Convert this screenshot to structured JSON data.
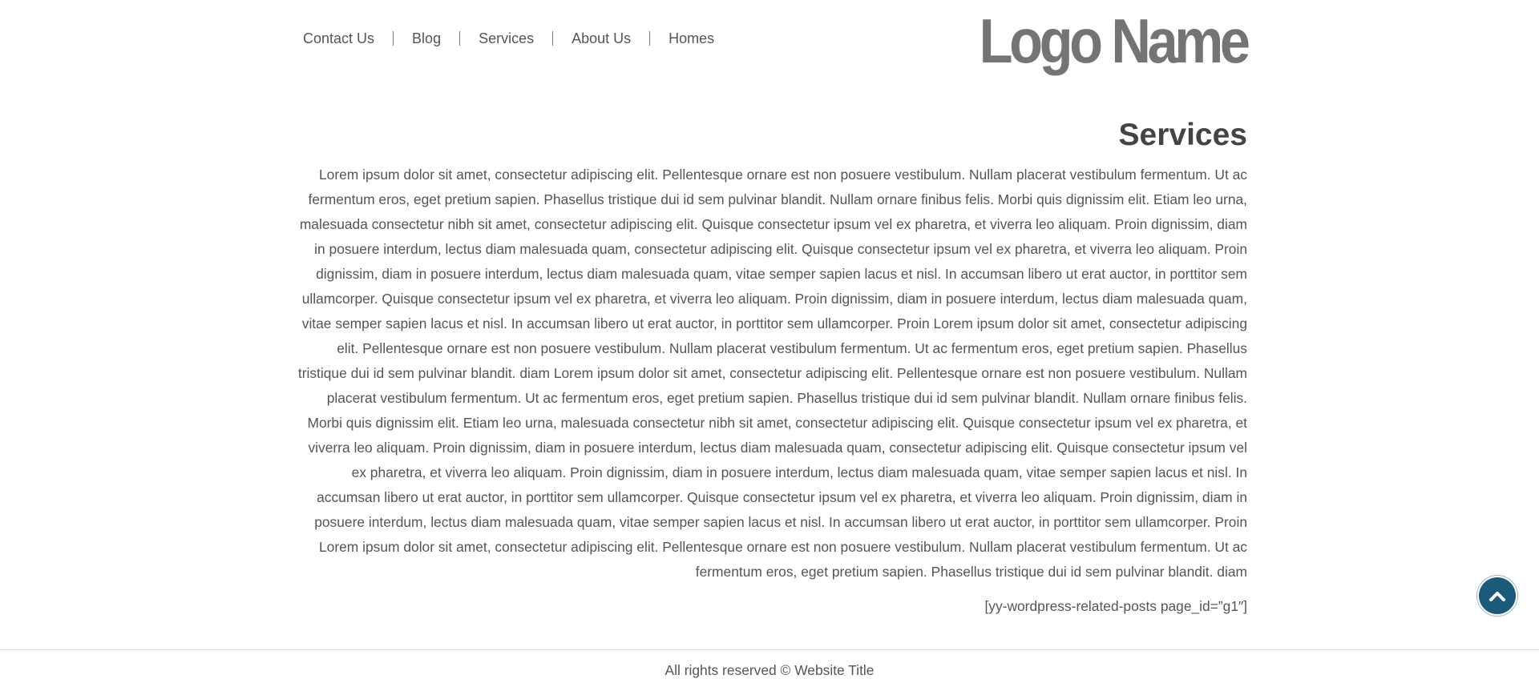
{
  "header": {
    "nav": [
      {
        "label": "Contact Us"
      },
      {
        "label": "Blog"
      },
      {
        "label": "Services"
      },
      {
        "label": "About Us"
      },
      {
        "label": "Homes"
      }
    ],
    "logo_text": "Logo Name"
  },
  "main": {
    "title": "Services",
    "body": "Lorem ipsum dolor sit amet, consectetur adipiscing elit. Pellentesque ornare est non posuere vestibulum. Nullam placerat vestibulum fermentum. Ut ac fermentum eros, eget pretium sapien. Phasellus tristique dui id sem pulvinar blandit. Nullam ornare finibus felis. Morbi quis dignissim elit. Etiam leo urna, malesuada consectetur nibh sit amet, consectetur adipiscing elit. Quisque consectetur ipsum vel ex pharetra, et viverra leo aliquam. Proin dignissim, diam in posuere interdum, lectus diam malesuada quam, consectetur adipiscing elit. Quisque consectetur ipsum vel ex pharetra, et viverra leo aliquam. Proin dignissim, diam in posuere interdum, lectus diam malesuada quam, vitae semper sapien lacus et nisl. In accumsan libero ut erat auctor, in porttitor sem ullamcorper. Quisque consectetur ipsum vel ex pharetra, et viverra leo aliquam. Proin dignissim, diam in posuere interdum, lectus diam malesuada quam, vitae semper sapien lacus et nisl. In accumsan libero ut erat auctor, in porttitor sem ullamcorper. Proin Lorem ipsum dolor sit amet, consectetur adipiscing elit. Pellentesque ornare est non posuere vestibulum. Nullam placerat vestibulum fermentum. Ut ac fermentum eros, eget pretium sapien. Phasellus tristique dui id sem pulvinar blandit. diam Lorem ipsum dolor sit amet, consectetur adipiscing elit. Pellentesque ornare est non posuere vestibulum. Nullam placerat vestibulum fermentum. Ut ac fermentum eros, eget pretium sapien. Phasellus tristique dui id sem pulvinar blandit. Nullam ornare finibus felis. Morbi quis dignissim elit. Etiam leo urna, malesuada consectetur nibh sit amet, consectetur adipiscing elit. Quisque consectetur ipsum vel ex pharetra, et viverra leo aliquam. Proin dignissim, diam in posuere interdum, lectus diam malesuada quam, consectetur adipiscing elit. Quisque consectetur ipsum vel ex pharetra, et viverra leo aliquam. Proin dignissim, diam in posuere interdum, lectus diam malesuada quam, vitae semper sapien lacus et nisl. In accumsan libero ut erat auctor, in porttitor sem ullamcorper. Quisque consectetur ipsum vel ex pharetra, et viverra leo aliquam. Proin dignissim, diam in posuere interdum, lectus diam malesuada quam, vitae semper sapien lacus et nisl. In accumsan libero ut erat auctor, in porttitor sem ullamcorper. Proin Lorem ipsum dolor sit amet, consectetur adipiscing elit. Pellentesque ornare est non posuere vestibulum. Nullam placerat vestibulum fermentum. Ut ac fermentum eros, eget pretium sapien. Phasellus tristique dui id sem pulvinar blandit. diam",
    "shortcode": "[yy-wordpress-related-posts page_id=”g1″]"
  },
  "footer": {
    "text": "All rights reserved © Website Title"
  },
  "back_to_top": {
    "icon": "chevron-up-icon"
  },
  "colors": {
    "back_to_top_bg": "#1a5a7a",
    "logo": "#747474",
    "title": "#444444",
    "text": "#555555"
  }
}
